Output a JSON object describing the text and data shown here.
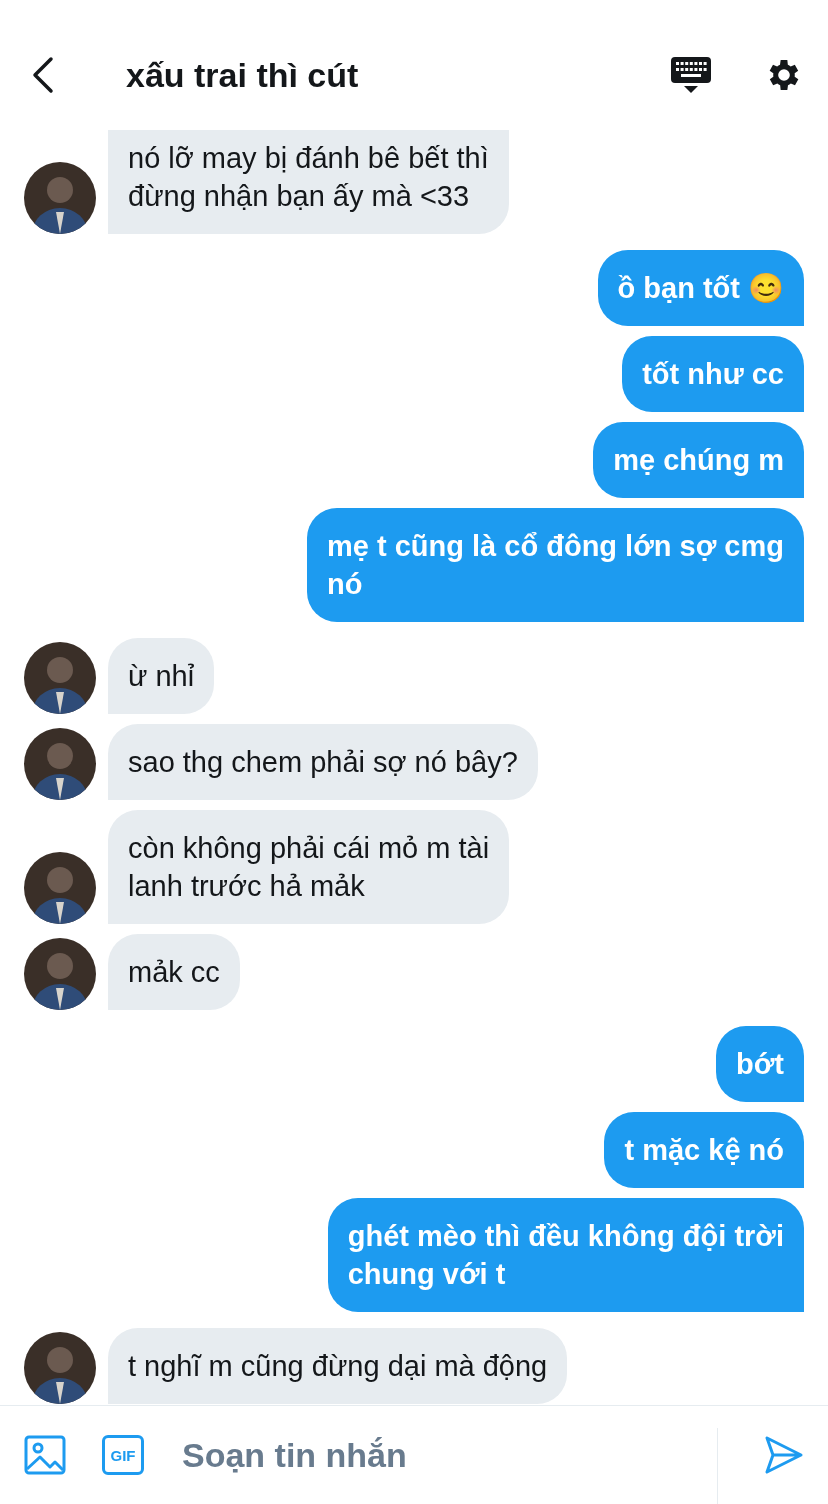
{
  "header": {
    "title": "xấu trai thì cút"
  },
  "messages": [
    {
      "kind": "incoming",
      "clipped": true,
      "text": "nó lỡ may bị đánh bê bết thì\nđừng nhận bạn ấy mà <33"
    },
    {
      "kind": "outgoing",
      "text": "ồ bạn tốt 😊"
    },
    {
      "kind": "outgoing",
      "text": "tốt như cc"
    },
    {
      "kind": "outgoing",
      "text": "mẹ chúng m"
    },
    {
      "kind": "outgoing",
      "text": "mẹ t cũng là cổ đông lớn sợ cmg\nnó"
    },
    {
      "kind": "incoming",
      "text": "ừ nhỉ"
    },
    {
      "kind": "incoming",
      "text": "sao thg chem phải sợ nó bây?"
    },
    {
      "kind": "incoming",
      "text": "còn không phải cái mỏ m tài\nlanh trước hả mảk"
    },
    {
      "kind": "incoming",
      "text": "mảk cc"
    },
    {
      "kind": "outgoing",
      "text": "bớt"
    },
    {
      "kind": "outgoing",
      "text": "t mặc kệ nó"
    },
    {
      "kind": "outgoing",
      "text": "ghét mèo thì đều không đội trời\nchung với t"
    },
    {
      "kind": "incoming",
      "text": "t nghĩ m cũng đừng dại mà động"
    }
  ],
  "composer": {
    "gif_label": "GIF",
    "placeholder": "Soạn tin nhắn"
  }
}
